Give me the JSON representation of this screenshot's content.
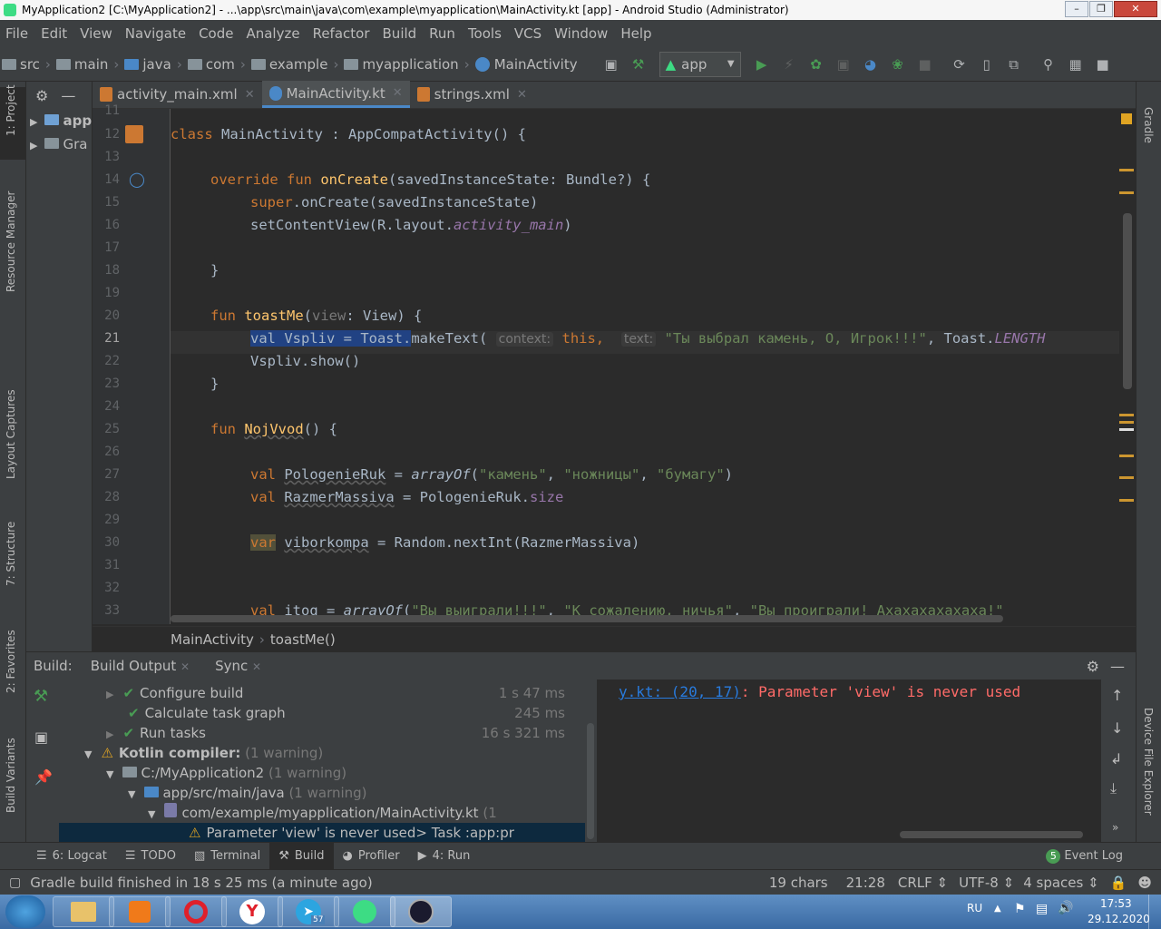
{
  "window": {
    "title": "MyApplication2 [C:\\MyApplication2] - ...\\app\\src\\main\\java\\com\\example\\myapplication\\MainActivity.kt [app] - Android Studio (Administrator)"
  },
  "menu": [
    "File",
    "Edit",
    "View",
    "Navigate",
    "Code",
    "Analyze",
    "Refactor",
    "Build",
    "Run",
    "Tools",
    "VCS",
    "Window",
    "Help"
  ],
  "navbar": {
    "crumbs": [
      "src",
      "main",
      "java",
      "com",
      "example",
      "myapplication",
      "MainActivity"
    ],
    "run_config": "app"
  },
  "left_stripe": {
    "project": "1: Project",
    "resource_manager": "Resource Manager",
    "layout_captures": "Layout Captures",
    "structure": "7: Structure",
    "favorites": "2: Favorites",
    "build_variants": "Build Variants"
  },
  "right_stripe": {
    "gradle": "Gradle",
    "device_file_explorer": "Device File Explorer"
  },
  "project_panel": {
    "items": [
      "app",
      "Gra"
    ]
  },
  "tabs": [
    {
      "label": "activity_main.xml",
      "color": "#cc7832"
    },
    {
      "label": "MainActivity.kt",
      "color": "#4a88c7",
      "active": true
    },
    {
      "label": "strings.xml",
      "color": "#cc7832"
    }
  ],
  "editor": {
    "line_numbers": [
      "11",
      "12",
      "13",
      "14",
      "15",
      "16",
      "17",
      "18",
      "19",
      "20",
      "21",
      "22",
      "23",
      "24",
      "25",
      "26",
      "27",
      "28",
      "29",
      "30",
      "31",
      "32",
      "33"
    ],
    "code": {
      "l12_class": "class",
      "l12_name": " MainActivity",
      "l12_rest": " : AppCompatActivity() {",
      "l14_kw": "override fun",
      "l14_fn": " onCreate",
      "l14_rest": "(savedInstanceState: Bundle?) {",
      "l15_kw": "super",
      "l15_rest": ".onCreate(savedInstanceState)",
      "l16_a": "setContentView(R.layout.",
      "l16_b": "activity_main",
      "l16_c": ")",
      "l18": "}",
      "l20_kw": "fun",
      "l20_fn": " toastMe",
      "l20_a": "(",
      "l20_param": "view",
      "l20_b": ": View) {",
      "l21_sel": "val Vspliv = Toast.",
      "l21_a": "makeText(",
      "l21_hint1": "context:",
      "l21_this": "this,",
      "l21_hint2": "text:",
      "l21_str": "\"Ты выбрал камень, О, Игрок!!!\"",
      "l21_b": ", Toast.",
      "l21_c": "LENGTH",
      "l22": "Vspliv.show()",
      "l23": "}",
      "l25_kw": "fun",
      "l25_fn": "NojVvod",
      "l25_rest": "() {",
      "l27_kw": "val",
      "l27_var": "PologenieRuk",
      "l27_a": " = ",
      "l27_fn": "arrayOf",
      "l27_b": "(",
      "l27_s1": "\"камень\"",
      "l27_s2": "\"ножницы\"",
      "l27_s3": "\"бумагу\"",
      "l27_c": ")",
      "l28_kw": "val",
      "l28_var": "RazmerMassiva",
      "l28_a": " = PologenieRuk.",
      "l28_prop": "size",
      "l30_kw": "var",
      "l30_var": "viborkompa",
      "l30_a": " = Random.nextInt(RazmerMassiva)",
      "l33_kw": "val",
      "l33_var": "itog",
      "l33_a": " = ",
      "l33_fn": "arrayOf",
      "l33_b": "(",
      "l33_s1": "\"Вы выиграли!!!\"",
      "l33_s2": "\"К сожалению, ничья\"",
      "l33_s3": "\"Вы проиграли! Ахахахахахаха!\""
    },
    "breadcrumb": [
      "MainActivity",
      "toastMe()"
    ]
  },
  "build": {
    "header_label": "Build:",
    "tabs": [
      "Build Output",
      "Sync"
    ],
    "tree": {
      "configure": {
        "label": "Configure build",
        "time": "1 s 47 ms"
      },
      "calculate": {
        "label": "Calculate task graph",
        "time": "245 ms"
      },
      "run_tasks": {
        "label": "Run tasks",
        "time": "16 s 321 ms"
      },
      "kotlin": {
        "label": "Kotlin compiler:",
        "count": "(1 warning)"
      },
      "path1": {
        "label": "C:/MyApplication2",
        "count": "(1 warning)"
      },
      "path2": {
        "label": "app/src/main/java",
        "count": "(1 warning)"
      },
      "path3": {
        "label": "com/example/myapplication/MainActivity.kt",
        "count": "(1"
      },
      "message": "Parameter 'view' is never used> Task :app:pr"
    },
    "output": {
      "link": "y.kt: (20, 17)",
      "colon": ": ",
      "message": "Parameter 'view' is never used"
    }
  },
  "bottom_tabs": [
    {
      "label": "6: Logcat"
    },
    {
      "label": "TODO"
    },
    {
      "label": "Terminal"
    },
    {
      "label": "Build",
      "active": true
    },
    {
      "label": "Profiler"
    },
    {
      "label": "4: Run"
    }
  ],
  "event_log": {
    "count": "5",
    "label": "Event Log"
  },
  "status": {
    "message": "Gradle build finished in 18 s 25 ms (a minute ago)",
    "chars": "19 chars",
    "position": "21:28",
    "line_sep": "CRLF",
    "encoding": "UTF-8",
    "indent": "4 spaces"
  },
  "taskbar": {
    "lang": "RU",
    "time": "17:53",
    "date": "29.12.2020",
    "telegram_badge": "57"
  }
}
